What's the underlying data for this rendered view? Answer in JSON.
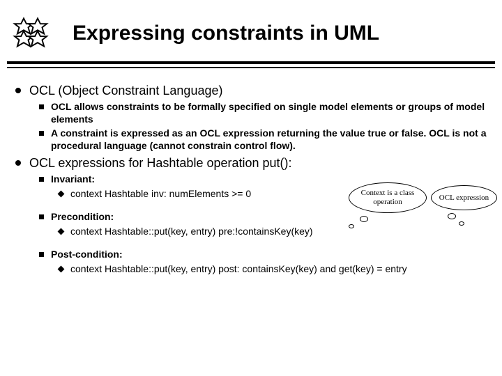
{
  "title": "Expressing constraints in UML",
  "sections": [
    {
      "text": "OCL (Object Constraint Language)",
      "sub": [
        {
          "text": "OCL allows constraints to be formally specified on single model elements or groups of model elements"
        },
        {
          "text": "A constraint is expressed as an OCL expression returning the value true or false.  OCL is not a procedural language (cannot constrain control flow)."
        }
      ]
    },
    {
      "text": "OCL expressions for Hashtable operation put():",
      "sub": [
        {
          "text": "Invariant:",
          "items": [
            "context Hashtable inv: numElements >= 0"
          ]
        },
        {
          "text": "Precondition:",
          "items": [
            "context Hashtable::put(key, entry) pre:!containsKey(key)"
          ]
        },
        {
          "text": "Post-condition:",
          "items": [
            "context Hashtable::put(key, entry) post: containsKey(key) and get(key) = entry"
          ]
        }
      ]
    }
  ],
  "callouts": {
    "bubble1": "Context is a class operation",
    "bubble2": "OCL expression"
  }
}
